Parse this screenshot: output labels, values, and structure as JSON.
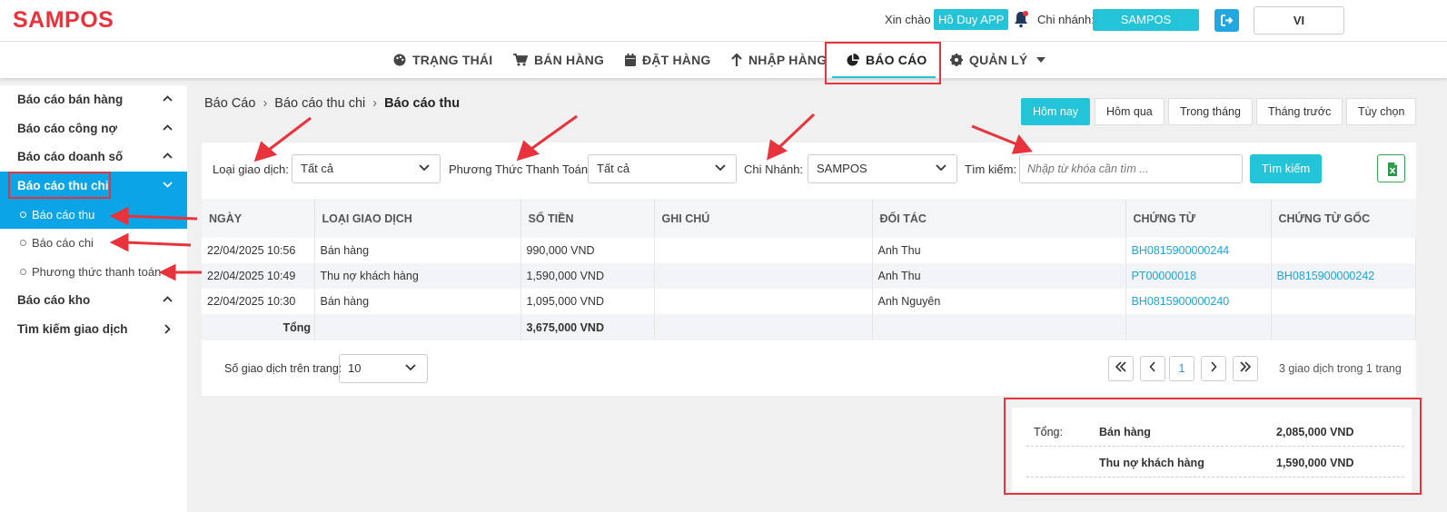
{
  "header": {
    "logo": "SAMPOS",
    "greeting": "Xin chào",
    "user": "Hồ Duy APP",
    "branch_label": "Chi nhánh:",
    "branch": "SAMPOS",
    "lang": "VI"
  },
  "nav": [
    {
      "label": "TRẠNG THÁI",
      "icon": "palette-icon"
    },
    {
      "label": "BÁN HÀNG",
      "icon": "cart-icon"
    },
    {
      "label": "ĐẶT HÀNG",
      "icon": "calendar-icon"
    },
    {
      "label": "NHẬP HÀNG",
      "icon": "arrow-up-icon"
    },
    {
      "label": "BÁO CÁO",
      "icon": "pie-chart-icon",
      "active": true
    },
    {
      "label": "QUẢN LÝ",
      "icon": "gear-icon"
    }
  ],
  "sidebar": {
    "items": [
      {
        "label": "Báo cáo bán hàng"
      },
      {
        "label": "Báo cáo công nợ"
      },
      {
        "label": "Báo cáo doanh số"
      },
      {
        "label": "Báo cáo thu chi",
        "active": true
      },
      {
        "label": "Báo cáo kho"
      },
      {
        "label": "Tìm kiếm giao dịch"
      }
    ],
    "sub_items": [
      {
        "label": "Báo cáo thu",
        "active": true
      },
      {
        "label": "Báo cáo chi"
      },
      {
        "label": "Phương thức thanh toán"
      }
    ]
  },
  "breadcrumb": [
    "Báo Cáo",
    "Báo cáo thu chi",
    "Báo cáo thu"
  ],
  "period_buttons": [
    "Hôm nay",
    "Hôm qua",
    "Trong tháng",
    "Tháng trước",
    "Tùy chọn"
  ],
  "filters": {
    "type_label": "Loại giao dịch:",
    "type_value": "Tất cả",
    "method_label": "Phương Thức Thanh Toán:",
    "method_value": "Tất cả",
    "branch_label": "Chi Nhánh:",
    "branch_value": "SAMPOS",
    "search_label": "Tìm kiếm:",
    "search_placeholder": "Nhập từ khóa cần tìm ...",
    "search_button": "Tìm kiếm"
  },
  "table": {
    "columns": [
      "NGÀY",
      "LOẠI GIAO DỊCH",
      "SỐ TIỀN",
      "GHI CHÚ",
      "ĐỐI TÁC",
      "CHỨNG TỪ",
      "CHỨNG TỪ GỐC"
    ],
    "rows": [
      [
        "22/04/2025 10:56",
        "Bán hàng",
        "990,000 VND",
        "",
        "Anh Thu",
        "BH0815900000244",
        ""
      ],
      [
        "22/04/2025 10:49",
        "Thu nợ khách hàng",
        "1,590,000 VND",
        "",
        "Anh Thu",
        "PT00000018",
        "BH0815900000242"
      ],
      [
        "22/04/2025 10:30",
        "Bán hàng",
        "1,095,000 VND",
        "",
        "Anh Nguyên",
        "BH0815900000240",
        ""
      ]
    ],
    "total_label": "Tổng",
    "total_value": "3,675,000 VND"
  },
  "pagination": {
    "per_page_label": "Số giao dịch trên trang:",
    "per_page": "10",
    "current": "1",
    "info": "3 giao dịch trong 1 trang"
  },
  "summary": {
    "label": "Tổng:",
    "rows": [
      {
        "name": "Bán hàng",
        "value": "2,085,000 VND"
      },
      {
        "name": "Thu nợ khách hàng",
        "value": "1,590,000 VND"
      }
    ]
  },
  "colors": {
    "brand": "#e8333c",
    "accent": "#23c4d8",
    "sidebar_active": "#0ba4e6",
    "link": "#17a6e0",
    "annotation": "#e8333c"
  }
}
